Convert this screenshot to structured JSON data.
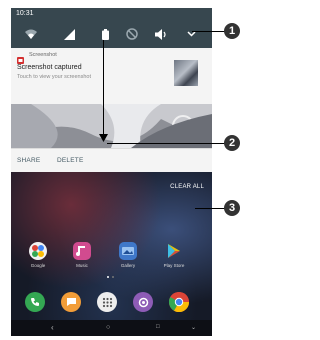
{
  "status_bar": {
    "time": "10:31"
  },
  "notification": {
    "app_name": "Screenshot",
    "title": "Screenshot captured",
    "subtitle": "Touch to view your screenshot",
    "actions": {
      "share": "SHARE",
      "delete": "DELETE"
    }
  },
  "home": {
    "clear_all": "CLEAR ALL",
    "apps": [
      {
        "label": "Google",
        "color": "#f2f2f2"
      },
      {
        "label": "Music",
        "color": "#d14b8f"
      },
      {
        "label": "Gallery",
        "color": "#3f78c9"
      },
      {
        "label": "Play Store",
        "color": "#26a862"
      }
    ],
    "dock": [
      {
        "name": "phone",
        "color": "#34a853"
      },
      {
        "name": "messages",
        "color": "#f29d38"
      },
      {
        "name": "app-drawer",
        "color": "#eeeeee"
      },
      {
        "name": "camera",
        "color": "#8e5cb6"
      },
      {
        "name": "chrome",
        "color": "#db4437"
      }
    ]
  },
  "callouts": [
    "1",
    "2",
    "3"
  ]
}
